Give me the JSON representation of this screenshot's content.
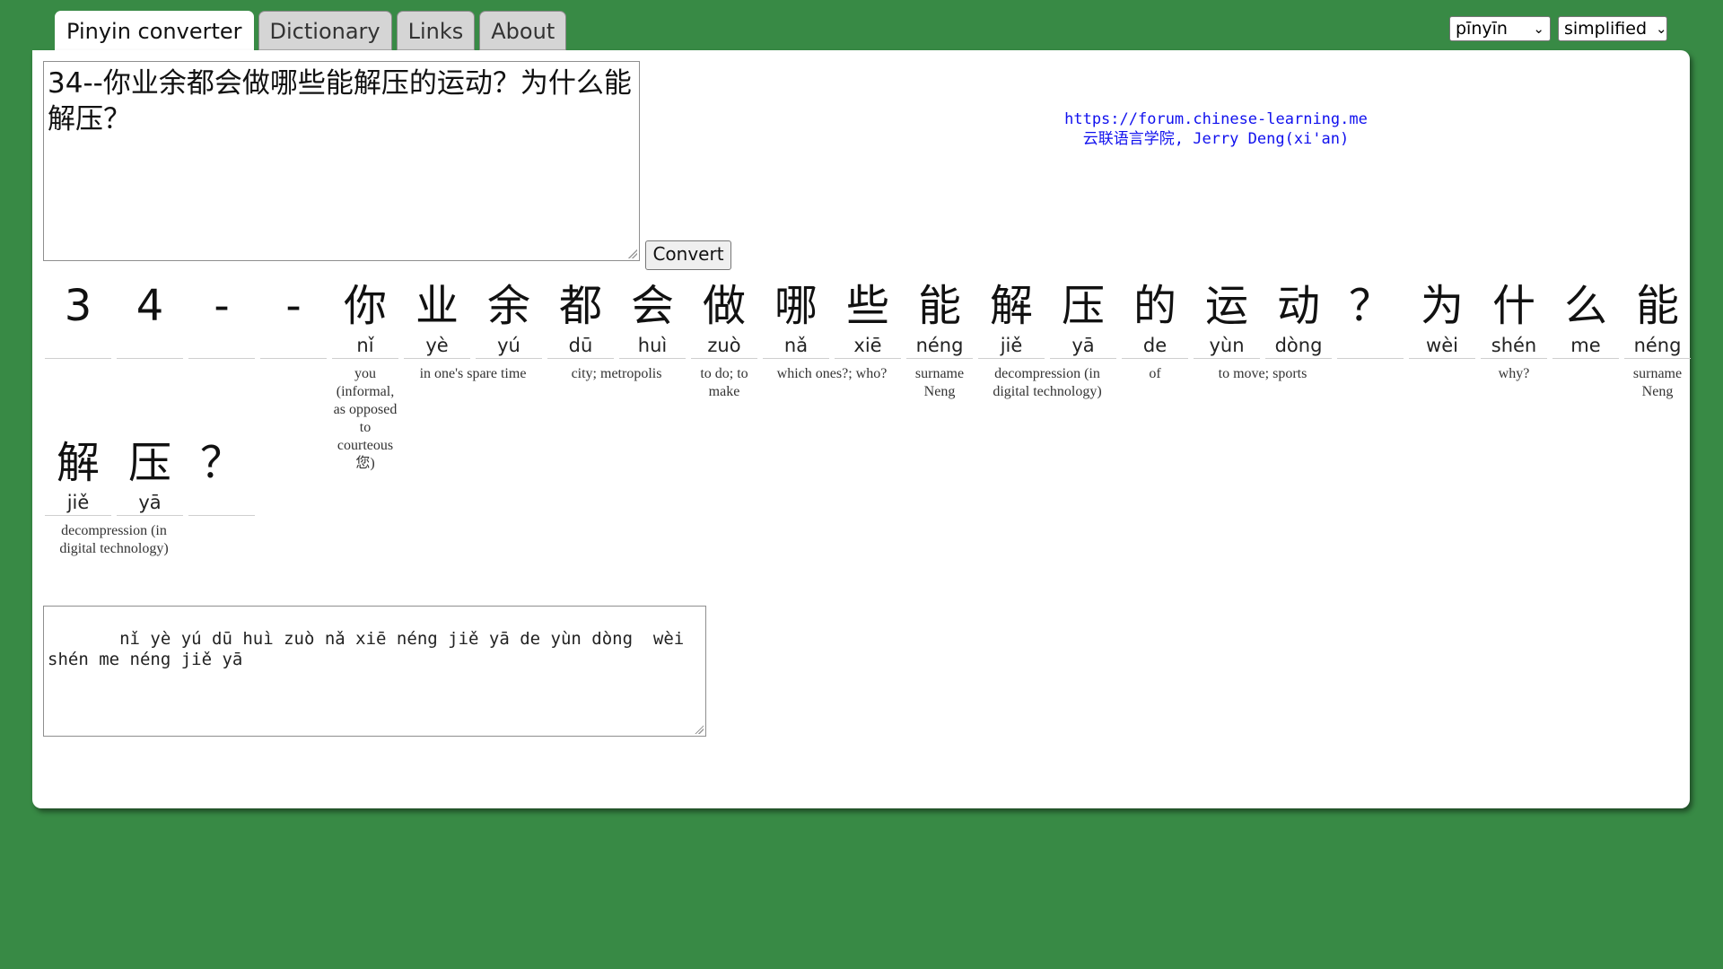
{
  "tabs": [
    "Pinyin converter",
    "Dictionary",
    "Links",
    "About"
  ],
  "selects": {
    "mode": "pīnyīn",
    "script": "simplified"
  },
  "input_text": "34--你业余都会做哪些能解压的运动？为什么能解压？",
  "convert_label": "Convert",
  "credit": {
    "line1": "https://forum.chinese-learning.me",
    "line2": "云联语言学院, Jerry Deng(xi'an)"
  },
  "row1": {
    "chars": [
      "3",
      "4",
      "-",
      "-",
      "你",
      "业",
      "余",
      "都",
      "会",
      "做",
      "哪",
      "些",
      "能",
      "解",
      "压",
      "的",
      "运",
      "动",
      "？",
      "为",
      "什",
      "么",
      "能"
    ],
    "pinyin": [
      "",
      "",
      "",
      "",
      "nǐ",
      "yè",
      "yú",
      "dū",
      "huì",
      "zuò",
      "nǎ",
      "xiē",
      "néng",
      "jiě",
      "yā",
      "de",
      "yùn",
      "dòng",
      "",
      "wèi",
      "shén",
      "me",
      "néng"
    ],
    "glosses": [
      "you (informal, as opposed to courteous 您)",
      "in one's spare time",
      "city; metropolis",
      "to do; to make",
      "which ones?; who?",
      "surname Neng",
      "decompression (in digital technology)",
      "of",
      "to move; sports",
      "why?",
      "surname Neng"
    ]
  },
  "row2": {
    "chars": [
      "解",
      "压",
      "？"
    ],
    "pinyin": [
      "jiě",
      "yā",
      ""
    ],
    "glosses": [
      "decompression (in digital technology)"
    ]
  },
  "output_text": "   nǐ yè yú dū huì zuò nǎ xiē néng jiě yā de yùn dòng  wèi shén me néng jiě yā"
}
